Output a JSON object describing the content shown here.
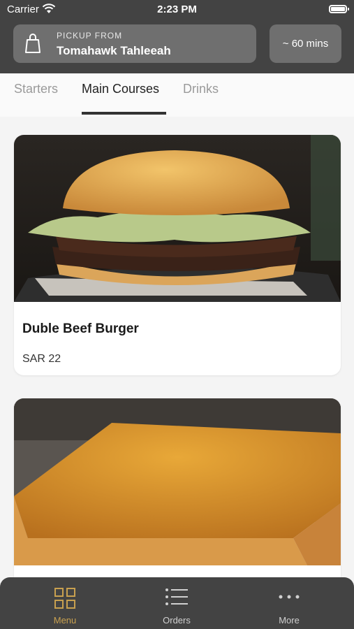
{
  "status_bar": {
    "carrier": "Carrier",
    "time": "2:23 PM"
  },
  "header": {
    "pickup_label": "PICKUP FROM",
    "pickup_location": "Tomahawk Tahleeah",
    "wait_time": "~ 60 mins"
  },
  "tabs": [
    {
      "label": "Starters",
      "active": false
    },
    {
      "label": "Main Courses",
      "active": true
    },
    {
      "label": "Drinks",
      "active": false
    }
  ],
  "menu_items": [
    {
      "name": "Duble Beef Burger",
      "price": "SAR 22"
    },
    {
      "name": "",
      "price": ""
    }
  ],
  "bottom_nav": [
    {
      "label": "Menu",
      "icon": "grid-icon",
      "active": true
    },
    {
      "label": "Orders",
      "icon": "list-icon",
      "active": false
    },
    {
      "label": "More",
      "icon": "more-dots-icon",
      "active": false
    }
  ],
  "colors": {
    "accent": "#c8a04f",
    "header_bg": "#434343",
    "card_bg": "#6f6f6f"
  }
}
